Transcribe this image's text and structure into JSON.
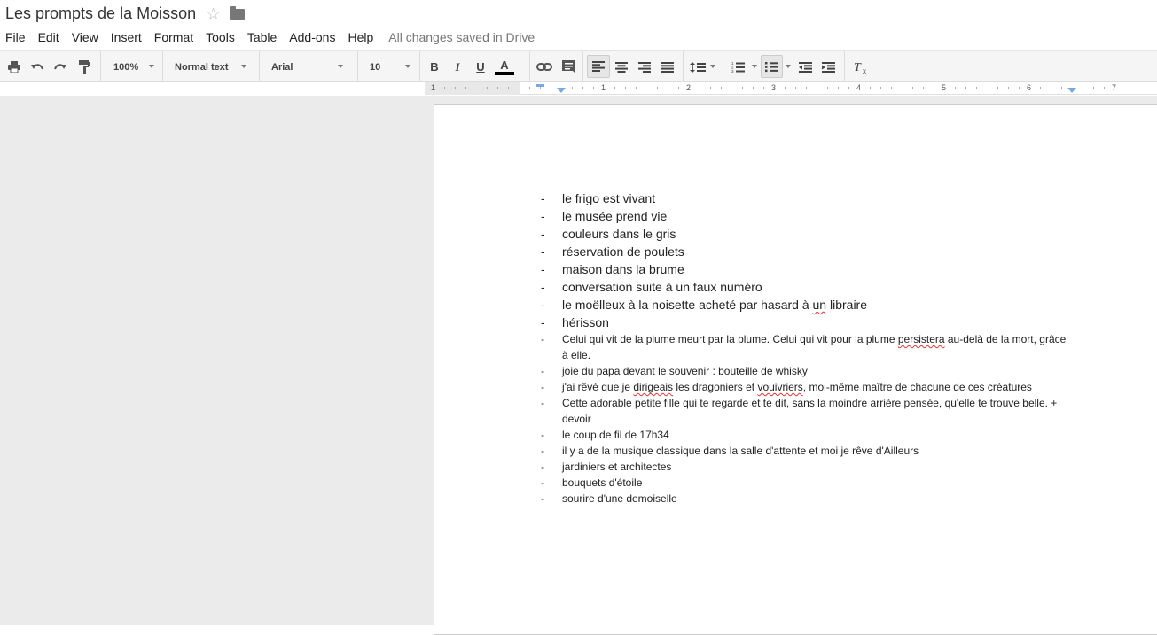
{
  "header": {
    "title": "Les prompts de la Moisson",
    "star_icon": "star-icon",
    "folder_icon": "folder-icon",
    "menu": [
      "File",
      "Edit",
      "View",
      "Insert",
      "Format",
      "Tools",
      "Table",
      "Add-ons",
      "Help"
    ],
    "save_status": "All changes saved in Drive"
  },
  "toolbar": {
    "zoom": "100%",
    "style": "Normal text",
    "font": "Arial",
    "size": "10",
    "icons": [
      "print-icon",
      "undo-icon",
      "redo-icon",
      "paint-format-icon",
      "bold-icon",
      "italic-icon",
      "underline-icon",
      "text-color-icon",
      "link-icon",
      "comment-icon",
      "align-left-icon",
      "align-center-icon",
      "align-right-icon",
      "justify-icon",
      "line-spacing-icon",
      "numbered-list-icon",
      "bulleted-list-icon",
      "decrease-indent-icon",
      "increase-indent-icon",
      "clear-formatting-icon"
    ],
    "text_color": "#000000"
  },
  "ruler": {
    "numbers": [
      "1",
      "1",
      "2",
      "3",
      "4",
      "5",
      "6",
      "7"
    ]
  },
  "document": {
    "bullet": "-",
    "items": [
      {
        "text": "le frigo est vivant",
        "size": "big"
      },
      {
        "text": "le musée prend vie",
        "size": "big"
      },
      {
        "text": "couleurs dans le gris",
        "size": "big"
      },
      {
        "text": "réservation de poulets",
        "size": "big"
      },
      {
        "text": "maison dans la brume",
        "size": "big"
      },
      {
        "text": "conversation suite à un faux numéro",
        "size": "big"
      },
      {
        "text": "le moëlleux à la noisette acheté par hasard à un libraire",
        "size": "big"
      },
      {
        "text": "hérisson",
        "size": "big"
      },
      {
        "text": "Celui qui vit de la plume meurt par la plume. Celui qui vit pour la plume persistera au-delà de la mort, grâce à elle.",
        "size": "small"
      },
      {
        "text": "joie du papa devant le souvenir : bouteille de whisky",
        "size": "small"
      },
      {
        "text": "j'ai rêvé que je dirigeais les dragoniers et vouivriers, moi-même maître de chacune de ces créatures",
        "size": "small"
      },
      {
        "text": "Cette adorable petite fille qui te regarde et te dit, sans la moindre arrière pensée, qu'elle te trouve belle. + devoir",
        "size": "small"
      },
      {
        "text": "le coup de fil de 17h34",
        "size": "small"
      },
      {
        "text": "il y a de la musique classique dans la salle d'attente et moi je rêve d'Ailleurs",
        "size": "small"
      },
      {
        "text": "jardiniers et architectes",
        "size": "small"
      },
      {
        "text": "bouquets d'étoile",
        "size": "small"
      },
      {
        "text": "sourire d'une demoiselle",
        "size": "small"
      }
    ]
  }
}
